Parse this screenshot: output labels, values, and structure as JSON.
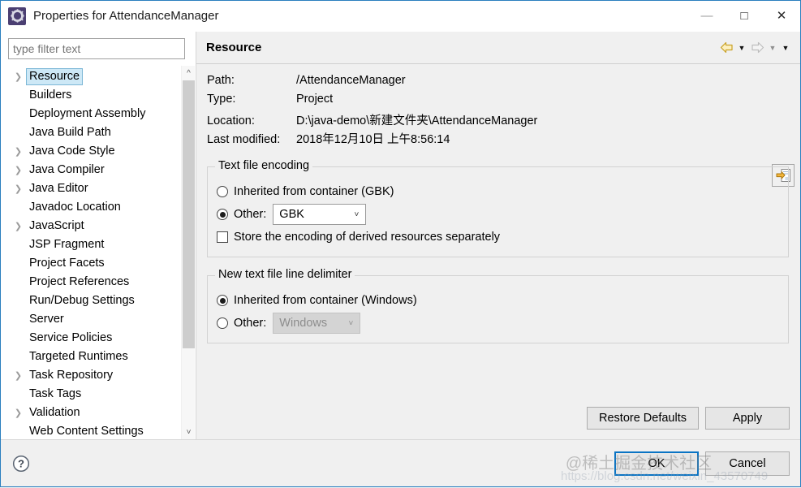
{
  "window": {
    "title": "Properties for AttendanceManager",
    "icon": "eclipse-gear-icon",
    "minimize_label": "—",
    "maximize_label": "☐",
    "close_label": "✕"
  },
  "sidebar": {
    "filter": {
      "placeholder": "type filter text",
      "value": ""
    },
    "items": [
      {
        "label": "Resource",
        "expandable": true,
        "selected": true
      },
      {
        "label": "Builders",
        "expandable": false,
        "selected": false
      },
      {
        "label": "Deployment Assembly",
        "expandable": false,
        "selected": false
      },
      {
        "label": "Java Build Path",
        "expandable": false,
        "selected": false
      },
      {
        "label": "Java Code Style",
        "expandable": true,
        "selected": false
      },
      {
        "label": "Java Compiler",
        "expandable": true,
        "selected": false
      },
      {
        "label": "Java Editor",
        "expandable": true,
        "selected": false
      },
      {
        "label": "Javadoc Location",
        "expandable": false,
        "selected": false
      },
      {
        "label": "JavaScript",
        "expandable": true,
        "selected": false
      },
      {
        "label": "JSP Fragment",
        "expandable": false,
        "selected": false
      },
      {
        "label": "Project Facets",
        "expandable": false,
        "selected": false
      },
      {
        "label": "Project References",
        "expandable": false,
        "selected": false
      },
      {
        "label": "Run/Debug Settings",
        "expandable": false,
        "selected": false
      },
      {
        "label": "Server",
        "expandable": false,
        "selected": false
      },
      {
        "label": "Service Policies",
        "expandable": false,
        "selected": false
      },
      {
        "label": "Targeted Runtimes",
        "expandable": false,
        "selected": false
      },
      {
        "label": "Task Repository",
        "expandable": true,
        "selected": false
      },
      {
        "label": "Task Tags",
        "expandable": false,
        "selected": false
      },
      {
        "label": "Validation",
        "expandable": true,
        "selected": false
      },
      {
        "label": "Web Content Settings",
        "expandable": false,
        "selected": false
      }
    ]
  },
  "pane": {
    "title": "Resource",
    "nav": {
      "back_icon": "back-arrow-icon",
      "back_menu_icon": "chevron-down-icon",
      "forward_icon": "forward-arrow-icon",
      "forward_menu_icon": "chevron-down-icon",
      "view_menu_icon": "chevron-down-icon"
    },
    "properties": [
      {
        "label": "Path:",
        "value": "/AttendanceManager"
      },
      {
        "label": "Type:",
        "value": "Project"
      },
      {
        "label": "Location:",
        "value": "D:\\java-demo\\新建文件夹\\AttendanceManager"
      },
      {
        "label": "Last modified:",
        "value": "2018年12月10日 上午8:56:14"
      }
    ],
    "location_button_icon": "edit-location-icon",
    "encoding_group": {
      "title": "Text file encoding",
      "inherited_label": "Inherited from container (GBK)",
      "inherited_selected": false,
      "other_label": "Other:",
      "other_selected": true,
      "other_value": "GBK",
      "store_separately_label": "Store the encoding of derived resources separately",
      "store_separately_checked": false
    },
    "delimiter_group": {
      "title": "New text file line delimiter",
      "inherited_label": "Inherited from container (Windows)",
      "inherited_selected": true,
      "other_label": "Other:",
      "other_selected": false,
      "other_value": "Windows",
      "other_disabled": true
    },
    "restore_defaults_label": "Restore Defaults",
    "apply_label": "Apply"
  },
  "footer": {
    "help_icon": "help-question-icon",
    "ok_label": "OK",
    "cancel_label": "Cancel"
  },
  "watermark": {
    "text_cn": "@稀土掘金技术社区",
    "text_url": "https://blog.csdn.net/weixin_43570749"
  },
  "colors": {
    "window_border": "#2a7fbf",
    "selection": "#cde8f6",
    "default_button_focus": "#0a74c4",
    "pane_background": "#f0f0f0"
  }
}
